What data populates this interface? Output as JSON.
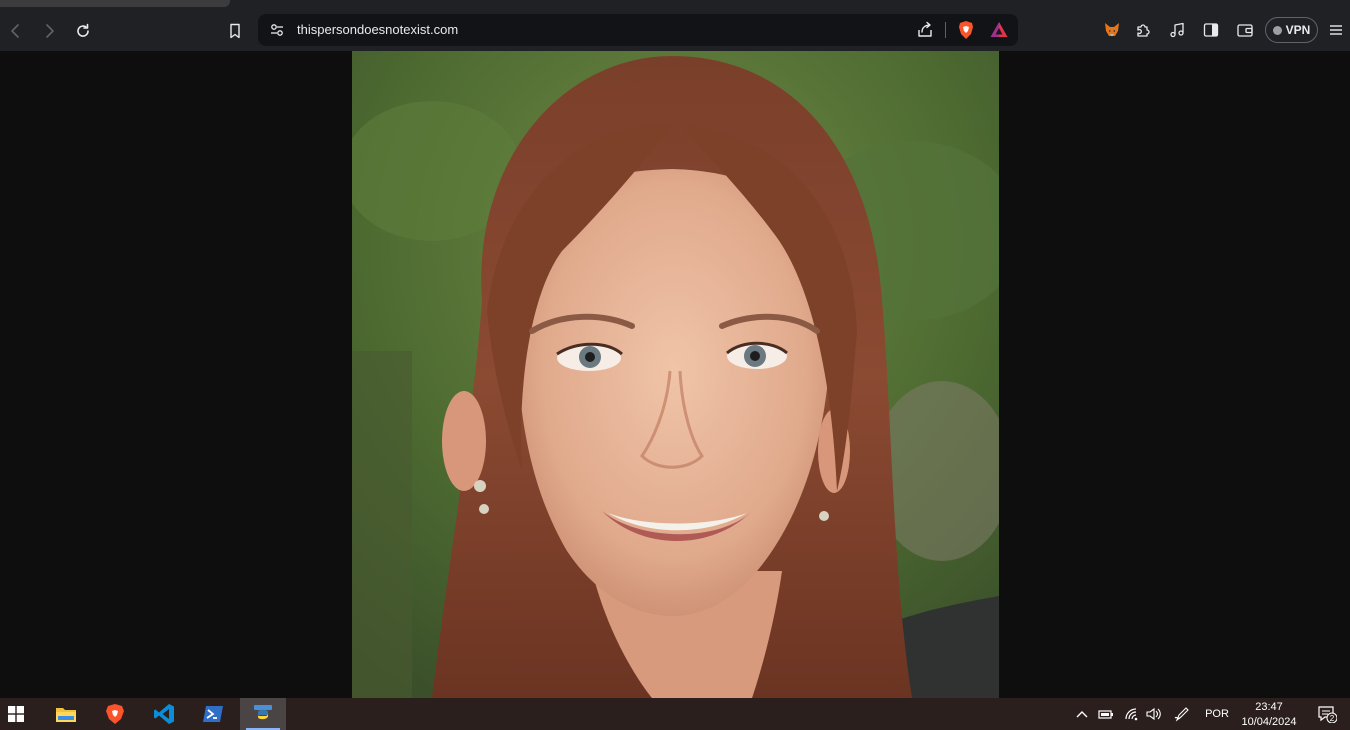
{
  "browser": {
    "url": "thispersondoesnotexist.com",
    "vpn_label": "VPN"
  },
  "taskbar": {
    "language": "POR",
    "time": "23:47",
    "date": "10/04/2024",
    "notification_count": "2"
  },
  "colors": {
    "toolbar_bg": "#202124",
    "content_bg": "#0e0e0e",
    "taskbar_bg": "#2a1f1d",
    "brave_orange": "#fb542b"
  }
}
